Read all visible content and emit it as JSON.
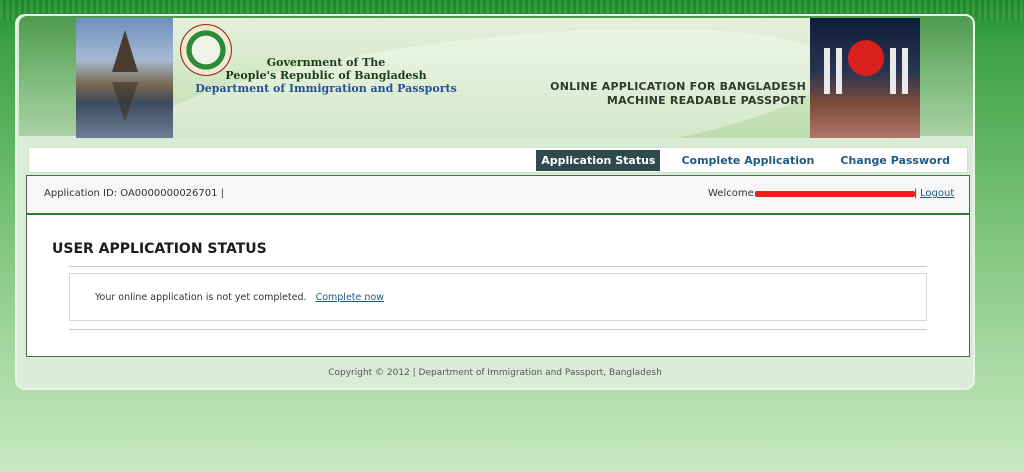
{
  "banner": {
    "gov_line1": "Government of The",
    "gov_line2": "People's Republic of Bangladesh",
    "gov_line3": "Department of Immigration and Passports",
    "title_line1": "ONLINE APPLICATION FOR BANGLADESH",
    "title_line2": "MACHINE READABLE PASSPORT"
  },
  "nav": {
    "items": [
      {
        "label": "Application Status",
        "active": true
      },
      {
        "label": "Complete Application",
        "active": false
      },
      {
        "label": "Change Password",
        "active": false
      }
    ]
  },
  "infobar": {
    "app_id": "Application ID: OA0000000026701 |",
    "welcome": "Welcome",
    "separator": "|",
    "logout": "Logout"
  },
  "main": {
    "title": "USER APPLICATION STATUS",
    "message": "Your online application is not yet completed.",
    "link": "Complete now"
  },
  "footer": {
    "copyright": "Copyright © 2012 | Department of Immigration and Passport, Bangladesh"
  },
  "colors": {
    "nav_active_bg": "#2f4a4d",
    "link": "#1e5a86",
    "redaction": "#e8221b",
    "accent_green": "#2f7a3a"
  }
}
